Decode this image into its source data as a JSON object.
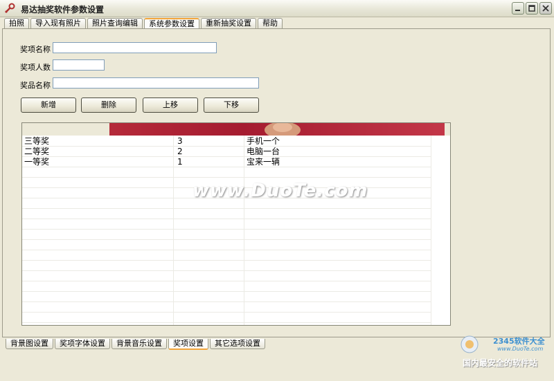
{
  "window": {
    "title": "易达抽奖软件参数设置"
  },
  "top_tabs": [
    {
      "label": "拍照"
    },
    {
      "label": "导入现有照片"
    },
    {
      "label": "照片查询编辑"
    },
    {
      "label": "系统参数设置",
      "active": true
    },
    {
      "label": "重新抽奖设置"
    },
    {
      "label": "帮助"
    }
  ],
  "form": {
    "prize_name_label": "奖项名称",
    "prize_name_value": "",
    "prize_count_label": "奖项人数",
    "prize_count_value": "",
    "gift_name_label": "奖品名称",
    "gift_name_value": ""
  },
  "buttons": {
    "add": "新增",
    "delete": "删除",
    "up": "上移",
    "down": "下移"
  },
  "grid": {
    "rows": [
      {
        "name": "三等奖",
        "count": "3",
        "gift": "手机一个"
      },
      {
        "name": "二等奖",
        "count": "2",
        "gift": "电脑一台"
      },
      {
        "name": "一等奖",
        "count": "1",
        "gift": "宝来一辆"
      }
    ]
  },
  "watermark": "www.DuoTe.com",
  "bottom_tabs": [
    {
      "label": "背景图设置"
    },
    {
      "label": "奖项字体设置"
    },
    {
      "label": "背景音乐设置"
    },
    {
      "label": "奖项设置",
      "active": true
    },
    {
      "label": "其它选项设置"
    }
  ],
  "branding": {
    "name": "2345软件大全",
    "url": "www.DuoTe.com",
    "slogan": "国内最安全的软件站"
  },
  "colors": {
    "accent_tab": "#f2a53b",
    "header_image": "#b52a3a",
    "brand": "#3b8fd0"
  }
}
